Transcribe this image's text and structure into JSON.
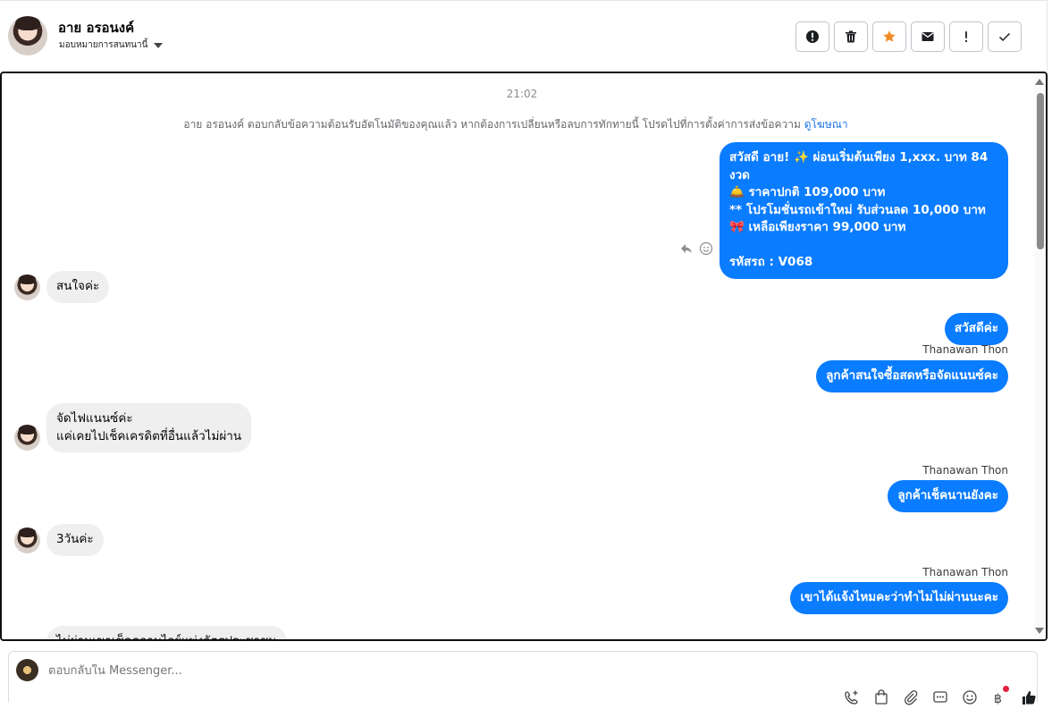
{
  "header": {
    "contact_name": "อาย อรอนงค์",
    "assign_label": "มอบหมายการสนทนานี้",
    "actions": [
      {
        "name": "spam-button",
        "icon": "alert-circle-icon"
      },
      {
        "name": "delete-button",
        "icon": "trash-icon"
      },
      {
        "name": "star-button",
        "icon": "star-icon"
      },
      {
        "name": "mark-unread-button",
        "icon": "envelope-icon"
      },
      {
        "name": "follow-up-button",
        "icon": "exclamation-icon"
      },
      {
        "name": "mark-done-button",
        "icon": "checkmark-icon"
      }
    ]
  },
  "conversation": {
    "timestamp": "21:02",
    "notice_text": "อาย อรอนงค์ ตอบกลับข้อความต้อนรับอัตโนมัติของคุณแล้ว หากต้องการเปลี่ยนหรือลบการทักทายนี้ โปรดไปที่การตั้งค่าการส่งข้อความ",
    "notice_link": "ดูโฆษณา",
    "messages": [
      {
        "dir": "out",
        "text": "สวัสดี อาย! ✨  ผ่อนเริ่มต้นเพียง 1,xxx. บาท 84 งวด\n🛎️ ราคาปกติ 109,000 บาท\n** โปรโมชั่นรถเข้าใหม่ รับส่วนลด 10,000 บาท\n🎀  เหลือเพียงราคา 99,000 บาท\n\n รหัสรถ : V068"
      },
      {
        "dir": "in",
        "text": "สนใจค่ะ"
      },
      {
        "dir": "out",
        "text": "สวัสดีค่ะ"
      },
      {
        "dir": "out",
        "sender": "Thanawan Thon",
        "text": "ลูกค้าสนใจซื้อสดหรือจัดแนนซ์คะ"
      },
      {
        "dir": "in",
        "text": "จัดไฟแนนซ์ค่ะ\nแค่เคยไปเช็คเครดิตที่อื่นแล้วไม่ผ่าน"
      },
      {
        "dir": "out",
        "sender": "Thanawan Thon",
        "text": "ลูกค้าเช็คนานยังคะ"
      },
      {
        "dir": "in",
        "text": "3วันค่ะ"
      },
      {
        "dir": "out",
        "sender": "Thanawan Thon",
        "text": "เขาได้แจ้งไหมคะว่าทำไมไม่ผ่านนะคะ"
      },
      {
        "dir": "in",
        "text": "ไม่ผ่านเขาเช็คความไวย์แพ่งอัตรประชาชน"
      }
    ]
  },
  "composer": {
    "placeholder": "ตอบกลับใน Messenger...",
    "tools": [
      "add-contact-icon",
      "shopping-bag-icon",
      "paperclip-icon",
      "saved-replies-icon",
      "emoji-icon",
      "baht-icon",
      "like-icon"
    ]
  },
  "colors": {
    "outgoing_bubble": "#0a7cff",
    "incoming_bubble": "#efefef",
    "star": "#f08a24",
    "link": "#1b74e4"
  }
}
